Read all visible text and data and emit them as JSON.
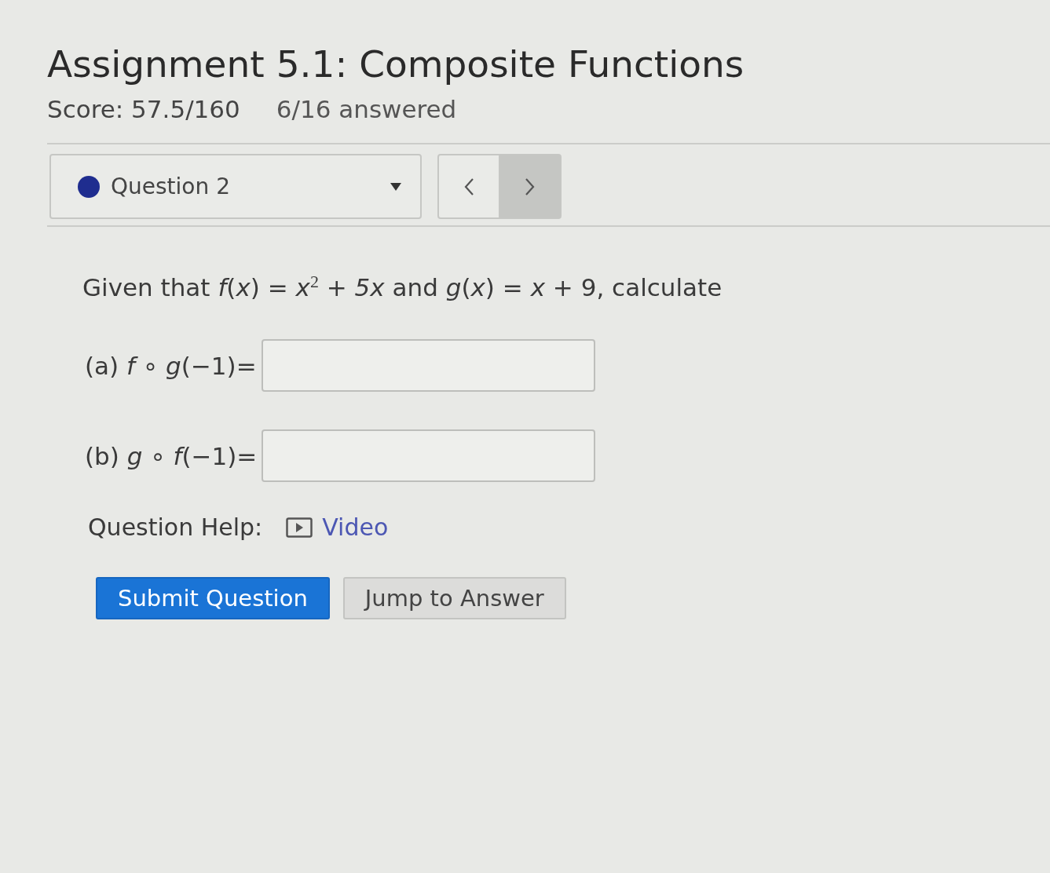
{
  "assignment": {
    "title": "Assignment 5.1: Composite Functions",
    "score": "Score: 57.5/160",
    "progress": "6/16 answered"
  },
  "question_selector": {
    "label": "Question 2",
    "color": "#1f2d8f"
  },
  "navigation": [
    {
      "kind": "previous",
      "highlighted": false
    },
    {
      "kind": "next",
      "highlighted": true
    }
  ],
  "question": {
    "prompt": "Given that *f*(*x*) = *x*$^{2}$ + *5x* and *g*(*x*) = *x* + 9, calculate",
    "parts": [
      {
        "label": "(a) *f* ∘ *g*(−1)="
      },
      {
        "label": "(b) *g* ∘ *f*(−1)="
      }
    ]
  },
  "help": {
    "label": "Question Help:",
    "link": "Video"
  },
  "buttons": [
    {
      "kind": "primary",
      "label": "Submit Question"
    },
    {
      "kind": "secondary",
      "label": "Jump to Answer"
    }
  ]
}
